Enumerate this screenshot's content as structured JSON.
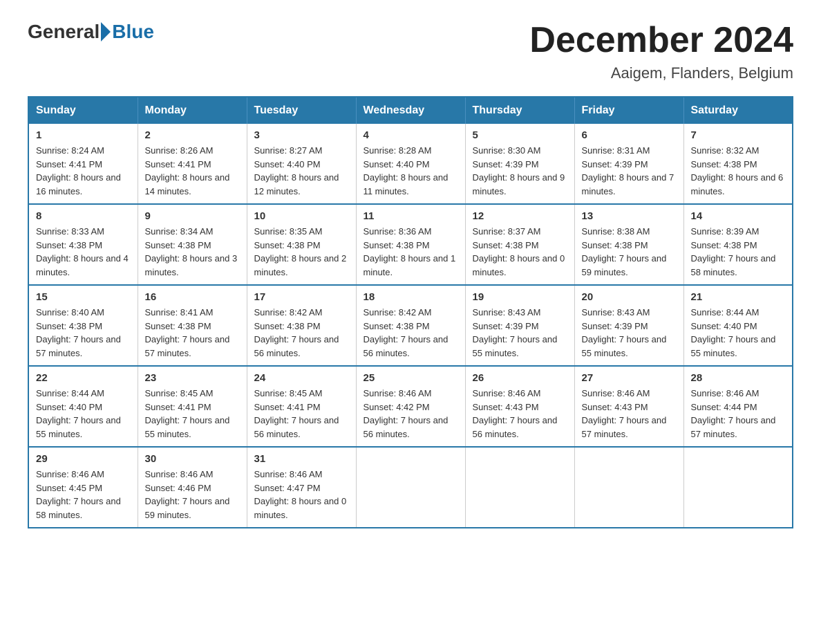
{
  "header": {
    "logo": {
      "general": "General",
      "blue": "Blue"
    },
    "title": "December 2024",
    "location": "Aaigem, Flanders, Belgium"
  },
  "calendar": {
    "days_of_week": [
      "Sunday",
      "Monday",
      "Tuesday",
      "Wednesday",
      "Thursday",
      "Friday",
      "Saturday"
    ],
    "weeks": [
      [
        {
          "day": "1",
          "sunrise": "Sunrise: 8:24 AM",
          "sunset": "Sunset: 4:41 PM",
          "daylight": "Daylight: 8 hours and 16 minutes."
        },
        {
          "day": "2",
          "sunrise": "Sunrise: 8:26 AM",
          "sunset": "Sunset: 4:41 PM",
          "daylight": "Daylight: 8 hours and 14 minutes."
        },
        {
          "day": "3",
          "sunrise": "Sunrise: 8:27 AM",
          "sunset": "Sunset: 4:40 PM",
          "daylight": "Daylight: 8 hours and 12 minutes."
        },
        {
          "day": "4",
          "sunrise": "Sunrise: 8:28 AM",
          "sunset": "Sunset: 4:40 PM",
          "daylight": "Daylight: 8 hours and 11 minutes."
        },
        {
          "day": "5",
          "sunrise": "Sunrise: 8:30 AM",
          "sunset": "Sunset: 4:39 PM",
          "daylight": "Daylight: 8 hours and 9 minutes."
        },
        {
          "day": "6",
          "sunrise": "Sunrise: 8:31 AM",
          "sunset": "Sunset: 4:39 PM",
          "daylight": "Daylight: 8 hours and 7 minutes."
        },
        {
          "day": "7",
          "sunrise": "Sunrise: 8:32 AM",
          "sunset": "Sunset: 4:38 PM",
          "daylight": "Daylight: 8 hours and 6 minutes."
        }
      ],
      [
        {
          "day": "8",
          "sunrise": "Sunrise: 8:33 AM",
          "sunset": "Sunset: 4:38 PM",
          "daylight": "Daylight: 8 hours and 4 minutes."
        },
        {
          "day": "9",
          "sunrise": "Sunrise: 8:34 AM",
          "sunset": "Sunset: 4:38 PM",
          "daylight": "Daylight: 8 hours and 3 minutes."
        },
        {
          "day": "10",
          "sunrise": "Sunrise: 8:35 AM",
          "sunset": "Sunset: 4:38 PM",
          "daylight": "Daylight: 8 hours and 2 minutes."
        },
        {
          "day": "11",
          "sunrise": "Sunrise: 8:36 AM",
          "sunset": "Sunset: 4:38 PM",
          "daylight": "Daylight: 8 hours and 1 minute."
        },
        {
          "day": "12",
          "sunrise": "Sunrise: 8:37 AM",
          "sunset": "Sunset: 4:38 PM",
          "daylight": "Daylight: 8 hours and 0 minutes."
        },
        {
          "day": "13",
          "sunrise": "Sunrise: 8:38 AM",
          "sunset": "Sunset: 4:38 PM",
          "daylight": "Daylight: 7 hours and 59 minutes."
        },
        {
          "day": "14",
          "sunrise": "Sunrise: 8:39 AM",
          "sunset": "Sunset: 4:38 PM",
          "daylight": "Daylight: 7 hours and 58 minutes."
        }
      ],
      [
        {
          "day": "15",
          "sunrise": "Sunrise: 8:40 AM",
          "sunset": "Sunset: 4:38 PM",
          "daylight": "Daylight: 7 hours and 57 minutes."
        },
        {
          "day": "16",
          "sunrise": "Sunrise: 8:41 AM",
          "sunset": "Sunset: 4:38 PM",
          "daylight": "Daylight: 7 hours and 57 minutes."
        },
        {
          "day": "17",
          "sunrise": "Sunrise: 8:42 AM",
          "sunset": "Sunset: 4:38 PM",
          "daylight": "Daylight: 7 hours and 56 minutes."
        },
        {
          "day": "18",
          "sunrise": "Sunrise: 8:42 AM",
          "sunset": "Sunset: 4:38 PM",
          "daylight": "Daylight: 7 hours and 56 minutes."
        },
        {
          "day": "19",
          "sunrise": "Sunrise: 8:43 AM",
          "sunset": "Sunset: 4:39 PM",
          "daylight": "Daylight: 7 hours and 55 minutes."
        },
        {
          "day": "20",
          "sunrise": "Sunrise: 8:43 AM",
          "sunset": "Sunset: 4:39 PM",
          "daylight": "Daylight: 7 hours and 55 minutes."
        },
        {
          "day": "21",
          "sunrise": "Sunrise: 8:44 AM",
          "sunset": "Sunset: 4:40 PM",
          "daylight": "Daylight: 7 hours and 55 minutes."
        }
      ],
      [
        {
          "day": "22",
          "sunrise": "Sunrise: 8:44 AM",
          "sunset": "Sunset: 4:40 PM",
          "daylight": "Daylight: 7 hours and 55 minutes."
        },
        {
          "day": "23",
          "sunrise": "Sunrise: 8:45 AM",
          "sunset": "Sunset: 4:41 PM",
          "daylight": "Daylight: 7 hours and 55 minutes."
        },
        {
          "day": "24",
          "sunrise": "Sunrise: 8:45 AM",
          "sunset": "Sunset: 4:41 PM",
          "daylight": "Daylight: 7 hours and 56 minutes."
        },
        {
          "day": "25",
          "sunrise": "Sunrise: 8:46 AM",
          "sunset": "Sunset: 4:42 PM",
          "daylight": "Daylight: 7 hours and 56 minutes."
        },
        {
          "day": "26",
          "sunrise": "Sunrise: 8:46 AM",
          "sunset": "Sunset: 4:43 PM",
          "daylight": "Daylight: 7 hours and 56 minutes."
        },
        {
          "day": "27",
          "sunrise": "Sunrise: 8:46 AM",
          "sunset": "Sunset: 4:43 PM",
          "daylight": "Daylight: 7 hours and 57 minutes."
        },
        {
          "day": "28",
          "sunrise": "Sunrise: 8:46 AM",
          "sunset": "Sunset: 4:44 PM",
          "daylight": "Daylight: 7 hours and 57 minutes."
        }
      ],
      [
        {
          "day": "29",
          "sunrise": "Sunrise: 8:46 AM",
          "sunset": "Sunset: 4:45 PM",
          "daylight": "Daylight: 7 hours and 58 minutes."
        },
        {
          "day": "30",
          "sunrise": "Sunrise: 8:46 AM",
          "sunset": "Sunset: 4:46 PM",
          "daylight": "Daylight: 7 hours and 59 minutes."
        },
        {
          "day": "31",
          "sunrise": "Sunrise: 8:46 AM",
          "sunset": "Sunset: 4:47 PM",
          "daylight": "Daylight: 8 hours and 0 minutes."
        },
        null,
        null,
        null,
        null
      ]
    ]
  }
}
